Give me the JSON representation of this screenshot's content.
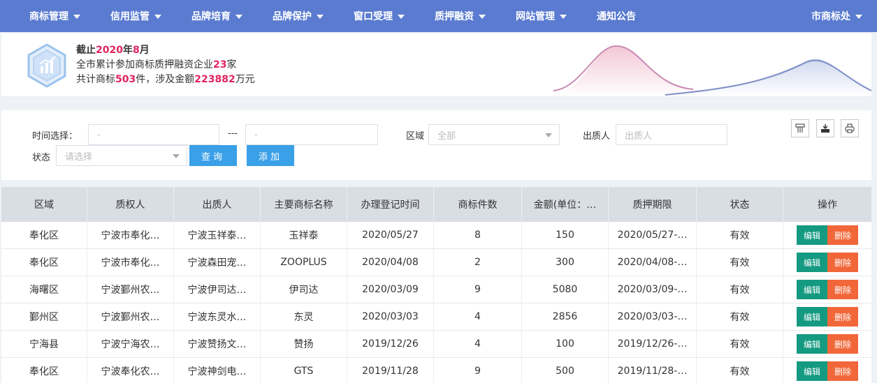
{
  "nav": {
    "items": [
      {
        "label": "商标管理",
        "caret": true
      },
      {
        "label": "信用监管",
        "caret": true
      },
      {
        "label": "品牌培育",
        "caret": true
      },
      {
        "label": "品牌保护",
        "caret": true
      },
      {
        "label": "窗口受理",
        "caret": true
      },
      {
        "label": "质押融资",
        "caret": true
      },
      {
        "label": "网站管理",
        "caret": true
      },
      {
        "label": "通知公告",
        "caret": false
      }
    ],
    "user": "市商标处"
  },
  "banner": {
    "l1a": "截止",
    "year": "2020",
    "l1b": "年",
    "month": "8",
    "l1c": "月",
    "l2a": "全市累计参加商标质押融资企业",
    "companies": "23",
    "l2b": "家",
    "l3a": "共计商标",
    "marks": "503",
    "l3b": "件，涉及金额",
    "amount": "223882",
    "l3c": "万元"
  },
  "filter": {
    "time_label": "时间选择：",
    "start_placeholder": "-",
    "sep": "---",
    "end_placeholder": "-",
    "region_label": "区域",
    "region_value": "全部",
    "pledgor_label": "出质人",
    "pledgor_placeholder": "出质人",
    "status_label": "状态",
    "status_placeholder": "请选择",
    "query_label": "查询",
    "add_label": "添加"
  },
  "table": {
    "headers": [
      "区域",
      "质权人",
      "出质人",
      "主要商标名称",
      "办理登记时间",
      "商标件数",
      "金额(单位：…",
      "质押期限",
      "状态",
      "操作"
    ],
    "edit_label": "编辑",
    "delete_label": "删除",
    "rows": [
      [
        "奉化区",
        "宁波市奉化…",
        "宁波玉祥泰…",
        "玉祥泰",
        "2020/05/27",
        "8",
        "150",
        "2020/05/27-…",
        "有效"
      ],
      [
        "奉化区",
        "宁波市奉化…",
        "宁波森田宠…",
        "ZOOPLUS",
        "2020/04/08",
        "2",
        "300",
        "2020/04/08-…",
        "有效"
      ],
      [
        "海曙区",
        "宁波鄞州农…",
        "宁波伊司达…",
        "伊司达",
        "2020/03/09",
        "9",
        "5080",
        "2020/03/09-…",
        "有效"
      ],
      [
        "鄞州区",
        "宁波鄞州农…",
        "宁波东灵水…",
        "东灵",
        "2020/03/03",
        "4",
        "2856",
        "2020/03/03-…",
        "有效"
      ],
      [
        "宁海县",
        "宁波宁海农…",
        "宁波赞扬文…",
        "赞扬",
        "2019/12/26",
        "4",
        "100",
        "2019/12/26-…",
        "有效"
      ],
      [
        "奉化区",
        "宁波奉化农…",
        "宁波神剑电…",
        "GTS",
        "2019/11/28",
        "9",
        "500",
        "2019/11/28-…",
        "有效"
      ]
    ]
  },
  "colors": {
    "nav": "#5a7bd0",
    "highlight": "#e0245e",
    "edit": "#149a80",
    "delete": "#f2673a",
    "primary": "#3aa0e8"
  }
}
